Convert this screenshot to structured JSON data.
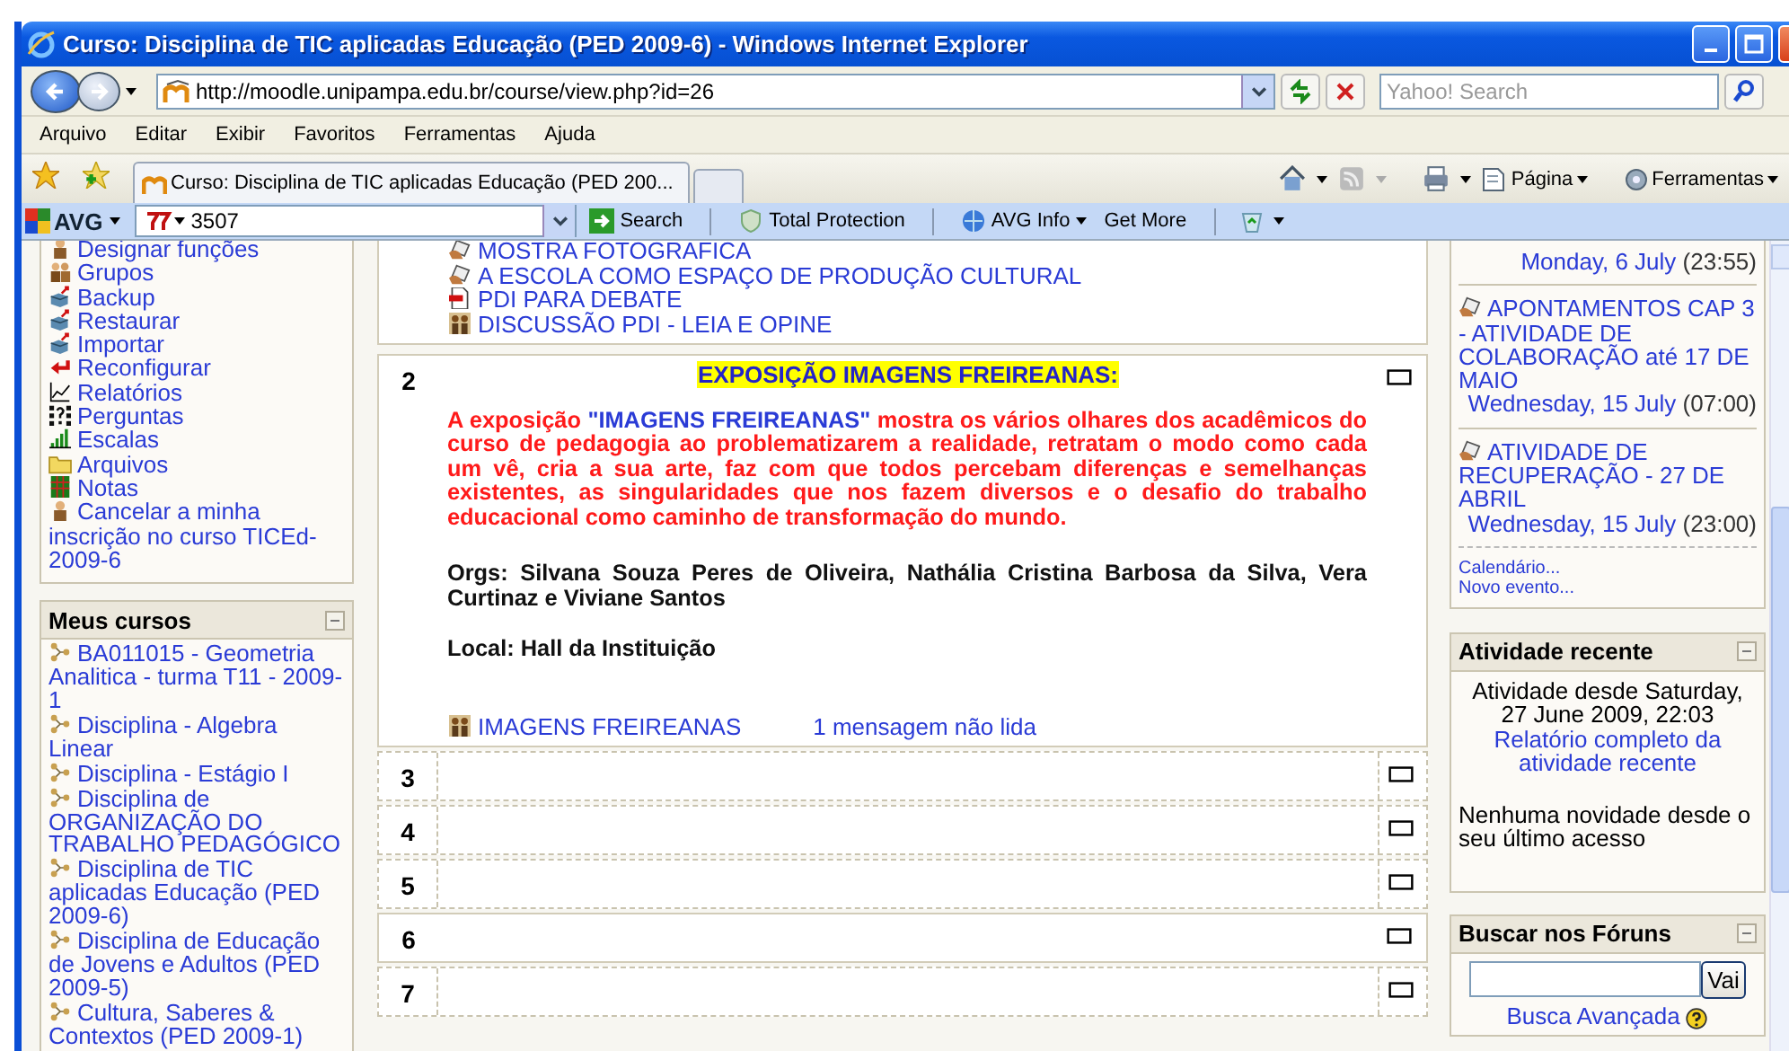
{
  "window": {
    "title": "Curso: Disciplina de TIC aplicadas Educação (PED 2009-6) - Windows Internet Explorer"
  },
  "address_bar": {
    "url": "http://moodle.unipampa.edu.br/course/view.php?id=26"
  },
  "search_field": {
    "placeholder": "Yahoo! Search"
  },
  "menu": [
    "Arquivo",
    "Editar",
    "Exibir",
    "Favoritos",
    "Ferramentas",
    "Ajuda"
  ],
  "tabs": [
    {
      "label": "Curso: Disciplina de TIC aplicadas Educação (PED 200...",
      "selected": true
    }
  ],
  "command_bar": [
    "Página",
    "Ferramentas"
  ],
  "avg_toolbar": {
    "brand": "AVG",
    "search_value": "3507",
    "buttons": [
      "Search",
      "Total Protection",
      "AVG Info",
      "Get More"
    ]
  },
  "administration": {
    "items": [
      "Designar funções",
      "Grupos",
      "Backup",
      "Restaurar",
      "Importar",
      "Reconfigurar",
      "Relatórios",
      "Perguntas",
      "Escalas",
      "Arquivos",
      "Notas",
      "Cancelar a minha inscrição no curso TICEd-2009-6"
    ]
  },
  "my_courses": {
    "title": "Meus cursos",
    "items": [
      "BA011015 - Geometria Analitica - turma T11 - 2009-1",
      "Disciplina - Algebra Linear",
      "Disciplina - Estágio I",
      "Disciplina de ORGANIZAÇÃO DO TRABALHO PEDAGÓGICO",
      "Disciplina de TIC aplicadas Educação (PED 2009-6)",
      "Disciplina de Educação de Jovens e Adultos (PED 2009-5)",
      "Cultura, Saberes & Contextos (PED 2009-1)"
    ]
  },
  "sections": [
    {
      "kind": "solid",
      "resources": [
        {
          "kind": "assignment",
          "label": "MOSTRA FOTOGRAFICA"
        },
        {
          "kind": "assignment",
          "label": "A ESCOLA COMO ESPAÇO DE PRODUÇÃO CULTURAL"
        },
        {
          "kind": "file",
          "label": "PDI PARA DEBATE"
        },
        {
          "kind": "forum",
          "label": "DISCUSSÃO PDI - LEIA E OPINE"
        }
      ]
    },
    {
      "kind": "solid",
      "number": "2",
      "heading": "EXPOSIÇÃO IMAGENS FREIREANAS:",
      "description": {
        "before": "A exposição ",
        "highlight": "\"IMAGENS FREIREANAS\"",
        "after": " mostra os vários olhares dos acadêmicos do curso de pedagogia ao problematizarem a realidade, retratam o modo como cada um vê, cria a sua arte, faz com que todos percebam diferenças e semelhanças existentes, as singularidades que nos fazem diversos e o desafio do trabalho educacional como caminho de transformação do mundo."
      },
      "orgs": "Orgs: Silvana Souza Peres de Oliveira, Nathália Cristina Barbosa da Silva, Vera Curtinaz e Viviane Santos",
      "local": "Local: Hall da Instituição",
      "resources": [
        {
          "kind": "forum",
          "label": "IMAGENS FREIREANAS",
          "unread": "1 mensagem não lida"
        }
      ]
    },
    {
      "kind": "dashed",
      "number": "3"
    },
    {
      "kind": "dashed",
      "number": "4"
    },
    {
      "kind": "dashed",
      "number": "5"
    },
    {
      "kind": "solid",
      "number": "6"
    },
    {
      "kind": "dashed",
      "number": "7"
    }
  ],
  "upcoming_events": {
    "events": [
      {
        "date": "Monday, 6 July",
        "time": "(23:55)"
      },
      {
        "title": "APONTAMENTOS CAP 3 - ATIVIDADE DE COLABORAÇÃO até 17 DE MAIO",
        "date": "Wednesday, 15 July",
        "time": "(07:00)"
      },
      {
        "title": "ATIVIDADE DE RECUPERAÇÃO - 27 DE ABRIL",
        "date": "Wednesday, 15 July",
        "time": "(23:00)"
      }
    ],
    "links": [
      "Calendário...",
      "Novo evento..."
    ]
  },
  "recent_activity": {
    "title": "Atividade recente",
    "since": "Atividade desde Saturday, 27 June 2009, 22:03",
    "report_link": "Relatório completo da atividade recente",
    "message": "Nenhuma novidade desde o seu último acesso"
  },
  "forum_search": {
    "title": "Buscar nos Fóruns",
    "button": "Vai",
    "advanced_link": "Busca Avançada"
  }
}
